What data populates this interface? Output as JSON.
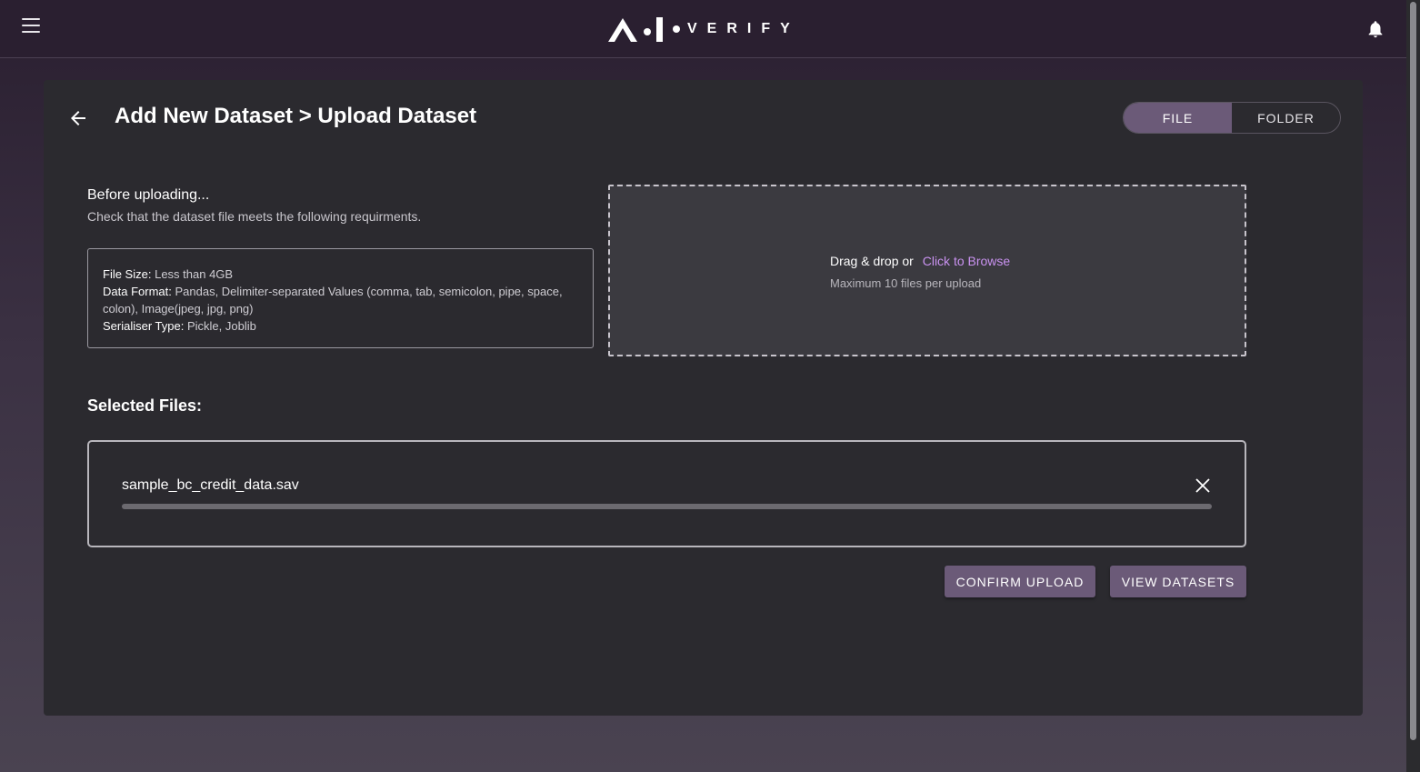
{
  "header": {
    "logo_text": "VERIFY",
    "menu_icon": "hamburger-menu-icon",
    "notification_icon": "bell-icon"
  },
  "page": {
    "title": "Add New Dataset > Upload Dataset",
    "back_icon": "arrow-left-icon"
  },
  "toggle": {
    "file_label": "FILE",
    "folder_label": "FOLDER",
    "active": "FILE"
  },
  "before": {
    "title": "Before uploading...",
    "subtitle": "Check that the dataset file meets the following requirments."
  },
  "requirements": {
    "file_size_label": "File Size:",
    "file_size_value": "Less than 4GB",
    "data_format_label": "Data Format:",
    "data_format_value": "Pandas, Delimiter-separated Values (comma, tab, semicolon, pipe, space, colon), Image(jpeg, jpg, png)",
    "serialiser_label": "Serialiser Type:",
    "serialiser_value": "Pickle, Joblib"
  },
  "dropzone": {
    "text": "Drag & drop or",
    "link": "Click to Browse",
    "note": "Maximum 10 files per upload"
  },
  "selected": {
    "title": "Selected Files:",
    "files": [
      {
        "name": "sample_bc_credit_data.sav",
        "progress": 1.0
      }
    ]
  },
  "actions": {
    "confirm_label": "CONFIRM UPLOAD",
    "view_label": "VIEW DATASETS"
  },
  "colors": {
    "accent": "#6b5a78",
    "link": "#c992f0",
    "panel": "#2b2a2f"
  }
}
